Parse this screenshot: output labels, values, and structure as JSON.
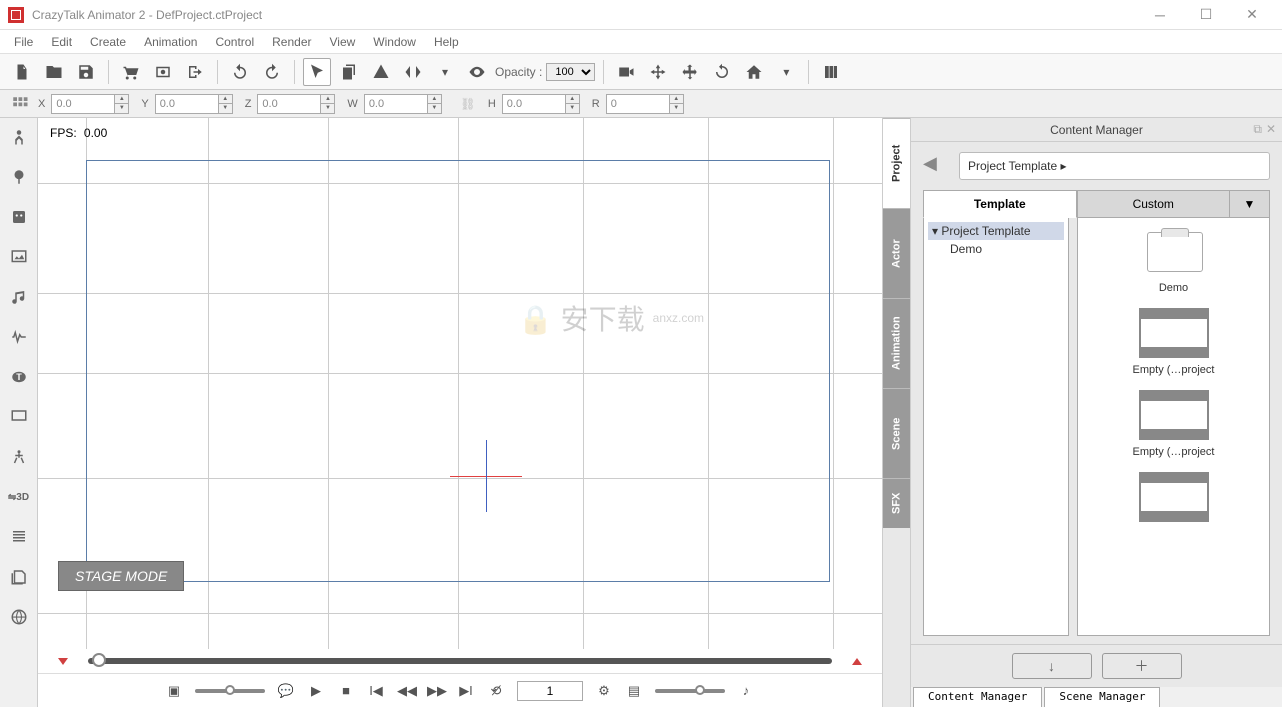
{
  "window": {
    "title": "CrazyTalk Animator 2   - DefProject.ctProject"
  },
  "menu": [
    "File",
    "Edit",
    "Create",
    "Animation",
    "Control",
    "Render",
    "View",
    "Window",
    "Help"
  ],
  "opacity": {
    "label": "Opacity :",
    "value": "100"
  },
  "coords": {
    "x_label": "X",
    "x": "0.0",
    "y_label": "Y",
    "y": "0.0",
    "z_label": "Z",
    "z": "0.0",
    "w_label": "W",
    "w": "0.0",
    "h_label": "H",
    "h": "0.0",
    "r_label": "R",
    "r": "0"
  },
  "stage": {
    "fps_label": "FPS:",
    "fps": "0.00",
    "mode": "STAGE MODE"
  },
  "timeline": {
    "frame": "1"
  },
  "content_manager": {
    "title": "Content Manager",
    "breadcrumb": "Project Template ▸",
    "tabs": {
      "template": "Template",
      "custom": "Custom"
    },
    "vtabs": [
      "Project",
      "Actor",
      "Animation",
      "Scene",
      "SFX"
    ],
    "tree": {
      "root": "Project Template",
      "child": "Demo"
    },
    "items": [
      {
        "label": "Demo",
        "kind": "folder"
      },
      {
        "label": "Empty (…project",
        "kind": "bars"
      },
      {
        "label": "Empty (…project",
        "kind": "bars"
      },
      {
        "label": "",
        "kind": "bars"
      }
    ],
    "bottom_tabs": [
      "Content Manager",
      "Scene Manager"
    ]
  }
}
